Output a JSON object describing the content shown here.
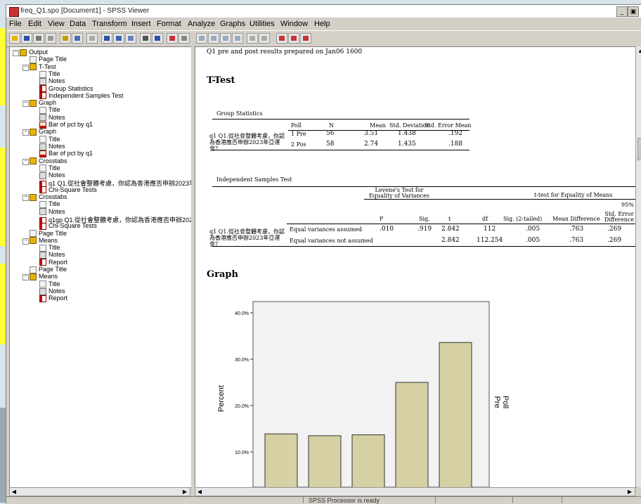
{
  "window": {
    "title": "freq_Q1.spo [Document1] - SPSS Viewer"
  },
  "menus": [
    "File",
    "Edit",
    "View",
    "Data",
    "Transform",
    "Insert",
    "Format",
    "Analyze",
    "Graphs",
    "Utilities",
    "Window",
    "Help"
  ],
  "outline": {
    "nodes": [
      {
        "label": "Output",
        "icon": "out-icon"
      },
      {
        "label": "Page Title",
        "icon": "page-title-icon"
      },
      {
        "label": "T-Test",
        "icon": "book-icon"
      },
      {
        "label": "Title",
        "icon": "page-icon"
      },
      {
        "label": "Notes",
        "icon": "notes-icon"
      },
      {
        "label": "Group Statistics",
        "icon": "table-icon"
      },
      {
        "label": "Independent Samples Test",
        "icon": "table-icon"
      },
      {
        "label": "Graph",
        "icon": "book-icon"
      },
      {
        "label": "Title",
        "icon": "page-icon"
      },
      {
        "label": "Notes",
        "icon": "notes-icon"
      },
      {
        "label": "Bar of pct by q1",
        "icon": "chart-icon"
      },
      {
        "label": "Graph",
        "icon": "book-icon"
      },
      {
        "label": "Title",
        "icon": "page-icon"
      },
      {
        "label": "Notes",
        "icon": "notes-icon"
      },
      {
        "label": "Bar of pct by q1",
        "icon": "chart-icon"
      },
      {
        "label": "Crosstabs",
        "icon": "book-icon"
      },
      {
        "label": "Title",
        "icon": "page-icon"
      },
      {
        "label": "Notes",
        "icon": "notes-icon"
      },
      {
        "label": "q1 Q1.從社會整體考慮，你認為香港應否申辦2023年",
        "icon": "table-icon"
      },
      {
        "label": "Chi-Square Tests",
        "icon": "table-icon"
      },
      {
        "label": "Crosstabs",
        "icon": "book-icon"
      },
      {
        "label": "Title",
        "icon": "page-icon"
      },
      {
        "label": "Notes",
        "icon": "notes-icon"
      },
      {
        "label": "q1gp Q1.從社會整體考慮，你認為香港應否申辦202",
        "icon": "table-icon"
      },
      {
        "label": "Chi-Square Tests",
        "icon": "table-icon"
      },
      {
        "label": "Page Title",
        "icon": "page-title-icon"
      },
      {
        "label": "Means",
        "icon": "book-icon"
      },
      {
        "label": "Title",
        "icon": "page-icon"
      },
      {
        "label": "Notes",
        "icon": "notes-icon"
      },
      {
        "label": "Report",
        "icon": "table-icon"
      },
      {
        "label": "Page Title",
        "icon": "page-title-icon"
      },
      {
        "label": "Means",
        "icon": "book-icon"
      },
      {
        "label": "Title",
        "icon": "page-icon"
      },
      {
        "label": "Notes",
        "icon": "notes-icon"
      },
      {
        "label": "Report",
        "icon": "table-icon"
      }
    ]
  },
  "content": {
    "page_title": "Q1 pre and post results prepared on Jan06 1600",
    "ttest_heading": "T-Test",
    "group_stats": {
      "caption": "Group Statistics",
      "headers": [
        "Poll",
        "N",
        "Mean",
        "Std. Deviation",
        "Std. Error Mean"
      ],
      "row_label": "q1  Q1.從社會整體考慮，你認為香港應否申辦2023年亞運會？",
      "rows": [
        [
          "1  Pre",
          "56",
          "3.51",
          "1.438",
          ".192"
        ],
        [
          "2  Pos",
          "58",
          "2.74",
          "1.435",
          ".188"
        ]
      ]
    },
    "ind_test": {
      "caption": "Independent Samples Test",
      "levene_header": "Levene's Test for Equality of Variances",
      "ttest_header": "t-test for Equality of Means",
      "ci_header": "95%",
      "headers": [
        "F",
        "Sig.",
        "t",
        "df",
        "Sig. (2-tailed)",
        "Mean Difference",
        "Std. Error Difference"
      ],
      "row_label": "q1  Q1.從社會整體考慮，你認為香港應否申辦2023年亞運會？",
      "rows": [
        {
          "label": "Equal variances assumed",
          "values": [
            ".010",
            ".919",
            "2.842",
            "112",
            ".005",
            ".763",
            ".269"
          ]
        },
        {
          "label": "Equal variances not assumed",
          "values": [
            "",
            "",
            "2.842",
            "112.254",
            ".005",
            ".763",
            ".269"
          ]
        }
      ]
    },
    "graph_heading": "Graph"
  },
  "chart_data": {
    "type": "bar",
    "ylabel": "Percent",
    "legend_title": "Poll",
    "legend_item": "Pre",
    "ytick_labels": [
      "10.0%",
      "20.0%",
      "30.0%",
      "40.0%"
    ],
    "values": [
      13.9,
      13.5,
      13.7,
      25.0,
      33.6
    ],
    "ylim": [
      0,
      42
    ],
    "bar_color": "#d6d1a4"
  },
  "status": {
    "text": "SPSS Processor  is ready"
  }
}
